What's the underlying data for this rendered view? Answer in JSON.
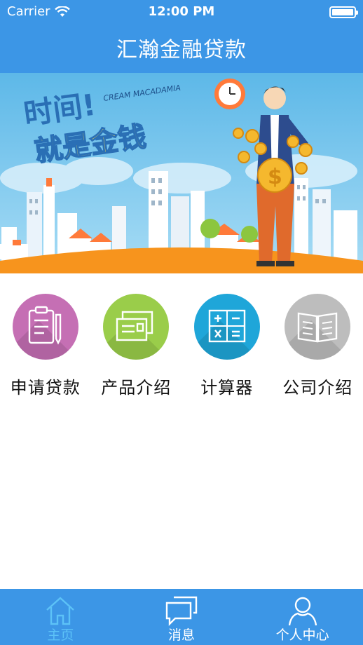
{
  "status_bar": {
    "carrier": "Carrier",
    "time": "12:00 PM"
  },
  "header": {
    "title": "汇瀚金融贷款"
  },
  "banner": {
    "headline_1": "时间!",
    "headline_2": "就是金钱",
    "brand": "CREAM MACADAMIA"
  },
  "menu": {
    "items": [
      {
        "label": "申请贷款",
        "icon": "clipboard-icon",
        "color": "#c56fb4"
      },
      {
        "label": "产品介绍",
        "icon": "cards-icon",
        "color": "#9acd4a"
      },
      {
        "label": "计算器",
        "icon": "calculator-icon",
        "color": "#1fa6d9"
      },
      {
        "label": "公司介绍",
        "icon": "book-icon",
        "color": "#bdbdbd"
      }
    ]
  },
  "tabbar": {
    "items": [
      {
        "label": "主页",
        "icon": "home-icon",
        "active": true
      },
      {
        "label": "消息",
        "icon": "message-icon",
        "active": false
      },
      {
        "label": "个人中心",
        "icon": "person-icon",
        "active": false
      }
    ]
  },
  "colors": {
    "primary": "#3c96e6",
    "tab_active": "#5cc2f7"
  }
}
